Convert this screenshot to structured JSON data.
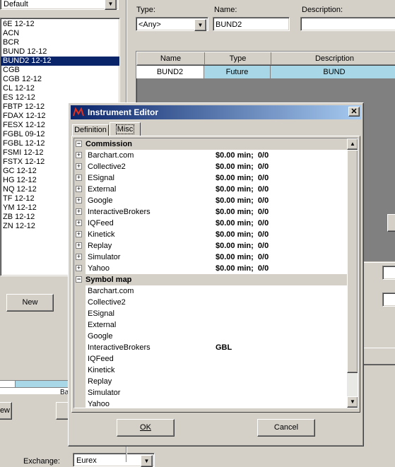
{
  "left_panel": {
    "dropdown_value": "Default",
    "instruments": [
      "6E 12-12",
      "ACN",
      "BCR",
      "BUND 12-12",
      "BUND2 12-12",
      "CGB",
      "CGB 12-12",
      "CL 12-12",
      "ES 12-12",
      "FBTP 12-12",
      "FDAX 12-12",
      "FESX 12-12",
      "FGBL 09-12",
      "FGBL 12-12",
      "FSMI 12-12",
      "FSTX 12-12",
      "GC 12-12",
      "HG 12-12",
      "NQ 12-12",
      "TF 12-12",
      "YM 12-12",
      "ZB 12-12",
      "ZN 12-12"
    ],
    "selected_index": 4,
    "new_button": "New",
    "view_button_partial": "ew",
    "exchange_label": "Exchange:",
    "exchange_value": "Eurex"
  },
  "filter": {
    "type_label": "Type:",
    "type_value": "<Any>",
    "name_label": "Name:",
    "name_value": "BUND2",
    "description_label": "Description:",
    "description_value": ""
  },
  "results_table": {
    "headers": [
      "Name",
      "Type",
      "Description"
    ],
    "row": [
      "BUND2",
      "Future",
      "BUND"
    ]
  },
  "dialog": {
    "title": "Instrument Editor",
    "tabs": [
      "Definition",
      "Misc"
    ],
    "active_tab": "Misc",
    "commission_header": "Commission",
    "commission_rows": [
      {
        "name": "Barchart.com",
        "value": "$0.00 min;  0/0"
      },
      {
        "name": "Collective2",
        "value": "$0.00 min;  0/0"
      },
      {
        "name": "ESignal",
        "value": "$0.00 min;  0/0"
      },
      {
        "name": "External",
        "value": "$0.00 min;  0/0"
      },
      {
        "name": "Google",
        "value": "$0.00 min;  0/0"
      },
      {
        "name": "InteractiveBrokers",
        "value": "$0.00 min;  0/0"
      },
      {
        "name": "IQFeed",
        "value": "$0.00 min;  0/0"
      },
      {
        "name": "Kinetick",
        "value": "$0.00 min;  0/0"
      },
      {
        "name": "Replay",
        "value": "$0.00 min;  0/0"
      },
      {
        "name": "Simulator",
        "value": "$0.00 min;  0/0"
      },
      {
        "name": "Yahoo",
        "value": "$0.00 min;  0/0"
      }
    ],
    "symbol_map_header": "Symbol map",
    "symbol_rows": [
      {
        "name": "Barchart.com",
        "value": ""
      },
      {
        "name": "Collective2",
        "value": ""
      },
      {
        "name": "ESignal",
        "value": ""
      },
      {
        "name": "External",
        "value": ""
      },
      {
        "name": "Google",
        "value": ""
      },
      {
        "name": "InteractiveBrokers",
        "value": "GBL"
      },
      {
        "name": "IQFeed",
        "value": ""
      },
      {
        "name": "Kinetick",
        "value": ""
      },
      {
        "name": "Replay",
        "value": ""
      },
      {
        "name": "Simulator",
        "value": ""
      },
      {
        "name": "Yahoo",
        "value": ""
      }
    ],
    "ok_button": "OK",
    "cancel_button": "Cancel"
  },
  "icons": {
    "app_icon": "ninjatrader-logo-icon",
    "close": "close-icon",
    "dropdown": "chevron-down-icon",
    "expand": "plus-expand-icon",
    "scroll_up": "arrow-up-icon",
    "scroll_down": "arrow-down-icon"
  },
  "colors": {
    "title_bar_start": "#0a246a",
    "title_bar_end": "#a6caf0",
    "selection": "#0a246a",
    "results_row_cell": "#a8d8e8"
  }
}
